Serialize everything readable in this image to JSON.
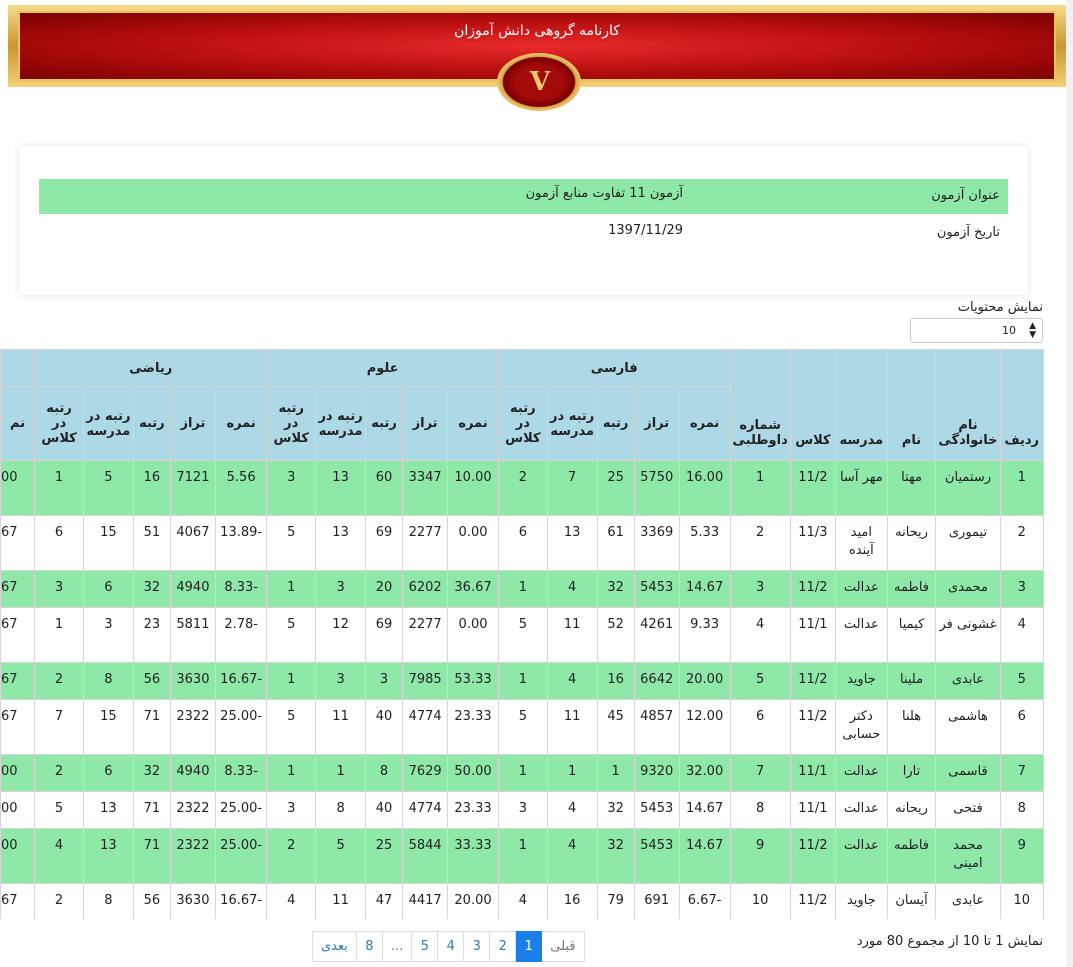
{
  "header": {
    "title": "کارنامه گروهی دانش آموزان",
    "emblem": "V"
  },
  "exam": {
    "title_label": "عنوان آزمون",
    "title_value": "آزمون 11 تفاوت منابع آزمون",
    "date_label": "تاریخ آزمون",
    "date_value": "1397/11/29"
  },
  "page_size": {
    "label": "نمایش محتویات",
    "value": "10"
  },
  "table": {
    "fixed_headers": [
      "ردیف",
      "نام خانوادگی",
      "نام",
      "مدرسه",
      "کلاس",
      "شماره داوطلبی"
    ],
    "groups": [
      "فارسی",
      "علوم",
      "ریاضی"
    ],
    "sub_headers": [
      "نمره",
      "تراز",
      "رتبه",
      "رتبه در مدرسه",
      "رتبه در کلاس"
    ],
    "partial_header": "نم",
    "rows": [
      [
        "1",
        "رستمیان",
        "مهتا",
        "مهر آسا",
        "11/2",
        "1",
        "16.00",
        "5750",
        "25",
        "7",
        "2",
        "10.00",
        "3347",
        "60",
        "13",
        "3",
        "5.56",
        "7121",
        "16",
        "5",
        "1",
        "00"
      ],
      [
        "2",
        "تیموری",
        "ریحانه",
        "امید آینده",
        "11/3",
        "2",
        "5.33",
        "3369",
        "61",
        "13",
        "6",
        "0.00",
        "2277",
        "69",
        "13",
        "5",
        "-13.89",
        "4067",
        "51",
        "15",
        "6",
        "67"
      ],
      [
        "3",
        "محمدی",
        "فاطمه",
        "عدالت",
        "11/2",
        "3",
        "14.67",
        "5453",
        "32",
        "4",
        "1",
        "36.67",
        "6202",
        "20",
        "3",
        "1",
        "-8.33",
        "4940",
        "32",
        "6",
        "3",
        "67"
      ],
      [
        "4",
        "غشونی فر",
        "کیمیا",
        "عدالت",
        "11/1",
        "4",
        "9.33",
        "4261",
        "52",
        "11",
        "5",
        "0.00",
        "2277",
        "69",
        "12",
        "5",
        "-2.78",
        "5811",
        "23",
        "3",
        "1",
        "67"
      ],
      [
        "5",
        "عابدی",
        "ملینا",
        "جاوید",
        "11/2",
        "5",
        "20.00",
        "6642",
        "16",
        "4",
        "1",
        "53.33",
        "7985",
        "3",
        "3",
        "1",
        "-16.67",
        "3630",
        "56",
        "8",
        "2",
        "67"
      ],
      [
        "6",
        "هاشمی",
        "هلنا",
        "دکتر حسابی",
        "11/2",
        "6",
        "12.00",
        "4857",
        "45",
        "11",
        "5",
        "23.33",
        "4774",
        "40",
        "11",
        "5",
        "-25.00",
        "2322",
        "71",
        "15",
        "7",
        "67"
      ],
      [
        "7",
        "قاسمی",
        "تارا",
        "عدالت",
        "11/1",
        "7",
        "32.00",
        "9320",
        "1",
        "1",
        "1",
        "50.00",
        "7629",
        "8",
        "1",
        "1",
        "-8.33",
        "4940",
        "32",
        "6",
        "2",
        "00"
      ],
      [
        "8",
        "فتحی",
        "ریحانه",
        "عدالت",
        "11/1",
        "8",
        "14.67",
        "5453",
        "32",
        "4",
        "3",
        "23.33",
        "4774",
        "40",
        "8",
        "3",
        "-25.00",
        "2322",
        "71",
        "13",
        "5",
        "00"
      ],
      [
        "9",
        "محمد امینی",
        "فاطمه",
        "عدالت",
        "11/2",
        "9",
        "14.67",
        "5453",
        "32",
        "4",
        "1",
        "33.33",
        "5844",
        "25",
        "5",
        "2",
        "-25.00",
        "2322",
        "71",
        "13",
        "4",
        "00"
      ],
      [
        "10",
        "عابدی",
        "آیسان",
        "جاوید",
        "11/2",
        "10",
        "-6.67",
        "691",
        "79",
        "16",
        "4",
        "20.00",
        "4417",
        "47",
        "11",
        "4",
        "-16.67",
        "3630",
        "56",
        "8",
        "2",
        "67"
      ]
    ]
  },
  "summary": "نمایش 1 تا 10 از مجموع 80 مورد",
  "pagination": [
    "قبلی",
    "1",
    "2",
    "3",
    "4",
    "5",
    "...",
    "8",
    "بعدی"
  ],
  "colors": {
    "header_bg": "#add8e6",
    "row_highlight": "#8ee8a8",
    "active_page": "#1a7fe8"
  }
}
